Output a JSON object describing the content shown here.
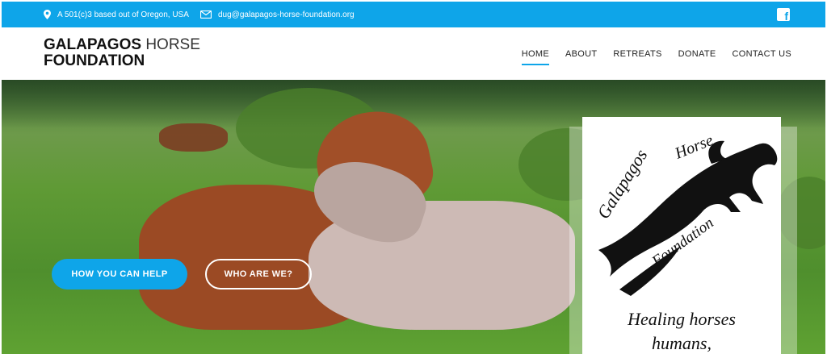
{
  "topbar": {
    "location_text": "A 501(c)3 based out of Oregon, USA",
    "email_text": "dug@galapagos-horse-foundation.org",
    "location_icon": "map-pin-icon",
    "email_icon": "envelope-icon",
    "social_icon": "facebook-icon"
  },
  "brand": {
    "line1_bold": "GALAPAGOS",
    "line1_light": " HORSE",
    "line2": "FOUNDATION"
  },
  "nav": {
    "items": [
      {
        "label": "HOME"
      },
      {
        "label": "ABOUT"
      },
      {
        "label": "RETREATS"
      },
      {
        "label": "DONATE"
      },
      {
        "label": "CONTACT US"
      }
    ],
    "active": "HOME"
  },
  "hero": {
    "primary_button": "HOW YOU CAN HELP",
    "secondary_button": "WHO ARE WE?"
  },
  "logo_panel": {
    "logo_word_galapagos": "Galapagos",
    "logo_word_horse": "Horse",
    "logo_word_foundation": "Foundation",
    "tagline_line1": "Healing horses",
    "tagline_line2": "humans,"
  },
  "colors": {
    "accent": "#0ea5e9",
    "text_dark": "#111111"
  }
}
